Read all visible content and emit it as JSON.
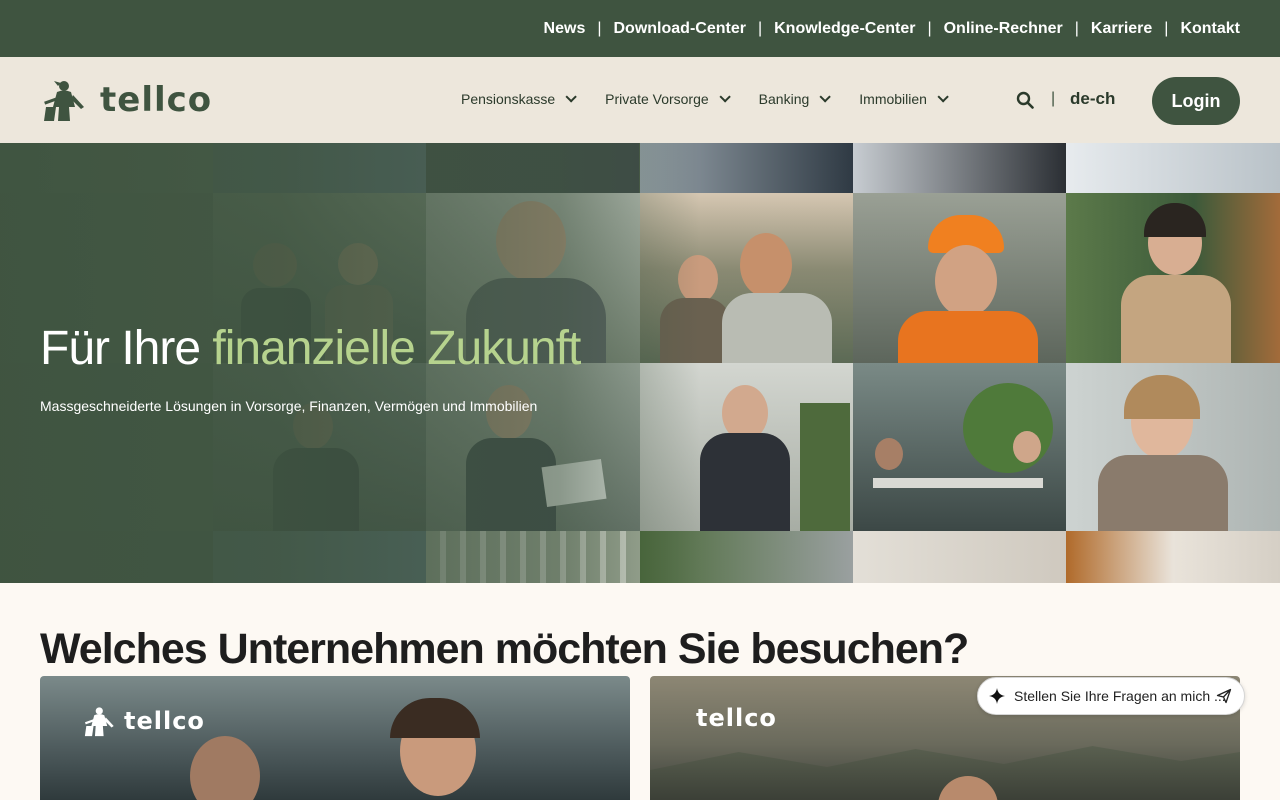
{
  "topbar": {
    "links": [
      "News",
      "Download-Center",
      "Knowledge-Center",
      "Online-Rechner",
      "Karriere",
      "Kontakt"
    ],
    "separator": "|"
  },
  "nav": {
    "logo_text": "tellco",
    "menu": [
      {
        "label": "Pensionskasse"
      },
      {
        "label": "Private Vorsorge"
      },
      {
        "label": "Banking"
      },
      {
        "label": "Immobilien"
      }
    ],
    "search_icon": "search-icon",
    "divider": "|",
    "language": "de-ch",
    "login_label": "Login"
  },
  "hero": {
    "title_plain": "Für Ihre ",
    "title_accent": "finanzielle Zukunft",
    "subtitle": "Massgeschneiderte Lösungen in Vorsorge, Finanzen, Vermögen und Immobilien"
  },
  "section": {
    "title": "Welches Unternehmen möchten Sie besuchen?",
    "cards": [
      {
        "logo_text": "tellco"
      },
      {
        "logo_text": "tellco"
      }
    ]
  },
  "chat": {
    "placeholder": "Stellen Sie Ihre Fragen an mich ...",
    "icon": "sparkle-icon",
    "send_icon": "send-icon"
  },
  "colors": {
    "brand_green": "#3f5440",
    "accent_green": "#b6d38e",
    "nav_beige": "#ede7dc",
    "page_bg": "#fdf9f3"
  }
}
